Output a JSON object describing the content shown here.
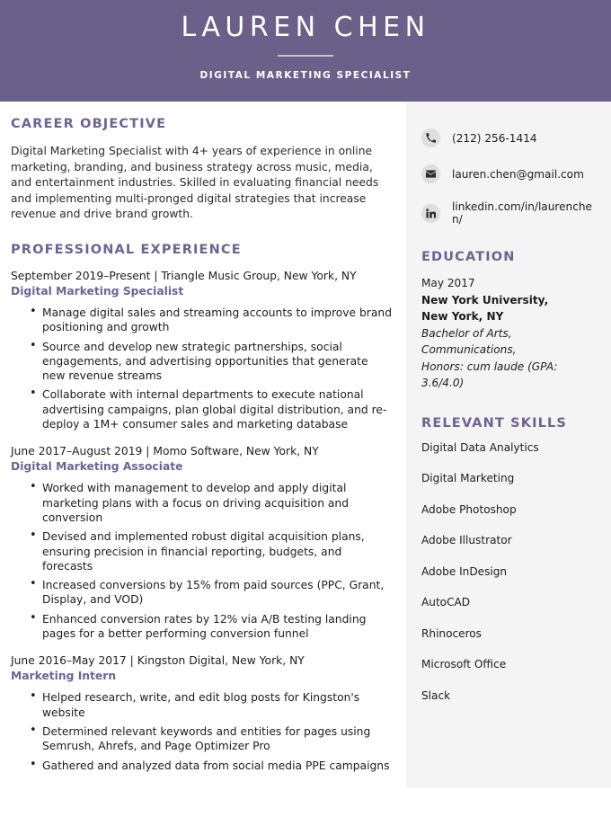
{
  "header": {
    "name": "LAUREN CHEN",
    "title": "DIGITAL MARKETING SPECIALIST",
    "accent_color": "#6a608a"
  },
  "objective": {
    "heading": "CAREER OBJECTIVE",
    "text": "Digital Marketing Specialist with 4+ years of experience in online marketing, branding, and business strategy across music, media, and entertainment industries. Skilled in evaluating financial needs and implementing multi-pronged digital strategies that increase revenue and drive brand growth."
  },
  "experience": {
    "heading": "PROFESSIONAL EXPERIENCE",
    "jobs": [
      {
        "meta": "September 2019–Present | Triangle Music Group, New York, NY",
        "role": "Digital Marketing Specialist",
        "bullets": [
          "Manage digital sales and streaming accounts to improve brand positioning and growth",
          "Source and develop new strategic partnerships, social engagements, and advertising opportunities that generate new revenue streams",
          "Collaborate with internal departments to execute national advertising campaigns, plan global digital distribution, and re-deploy a 1M+ consumer sales and marketing database"
        ]
      },
      {
        "meta": "June 2017–August 2019 | Momo Software, New York, NY",
        "role": "Digital Marketing Associate",
        "bullets": [
          "Worked with management to develop and apply digital marketing plans with a focus on driving acquisition and conversion",
          "Devised and implemented robust digital acquisition plans, ensuring precision in financial reporting, budgets, and forecasts",
          "Increased conversions by 15% from paid sources (PPC, Grant, Display, and VOD)",
          "Enhanced conversion rates by 12% via A/B testing landing pages for a better performing conversion funnel"
        ]
      },
      {
        "meta": "June 2016–May 2017 | Kingston Digital, New York, NY",
        "role": "Marketing Intern",
        "bullets": [
          "Helped research, write, and edit blog posts for Kingston's website",
          "Determined relevant keywords and entities for pages using Semrush, Ahrefs, and Page Optimizer Pro",
          "Gathered and analyzed data from social media PPE campaigns"
        ]
      }
    ]
  },
  "contact": [
    {
      "icon": "phone-icon",
      "value": "(212) 256-1414"
    },
    {
      "icon": "envelope-icon",
      "value": "lauren.chen@gmail.com"
    },
    {
      "icon": "linkedin-icon",
      "value": "linkedin.com/in/laurenchen/"
    }
  ],
  "education": {
    "heading": "EDUCATION",
    "date": "May 2017",
    "school_line1": "New York University,",
    "school_line2": "New York, NY",
    "degree_line1": "Bachelor of Arts, Communications,",
    "degree_line2": "Honors: cum laude (GPA: 3.6/4.0)"
  },
  "skills": {
    "heading": "RELEVANT SKILLS",
    "items": [
      "Digital Data Analytics",
      "Digital Marketing",
      "Adobe Photoshop",
      "Adobe Illustrator",
      "Adobe InDesign",
      "AutoCAD",
      "Rhinoceros",
      "Microsoft Office",
      "Slack"
    ]
  }
}
